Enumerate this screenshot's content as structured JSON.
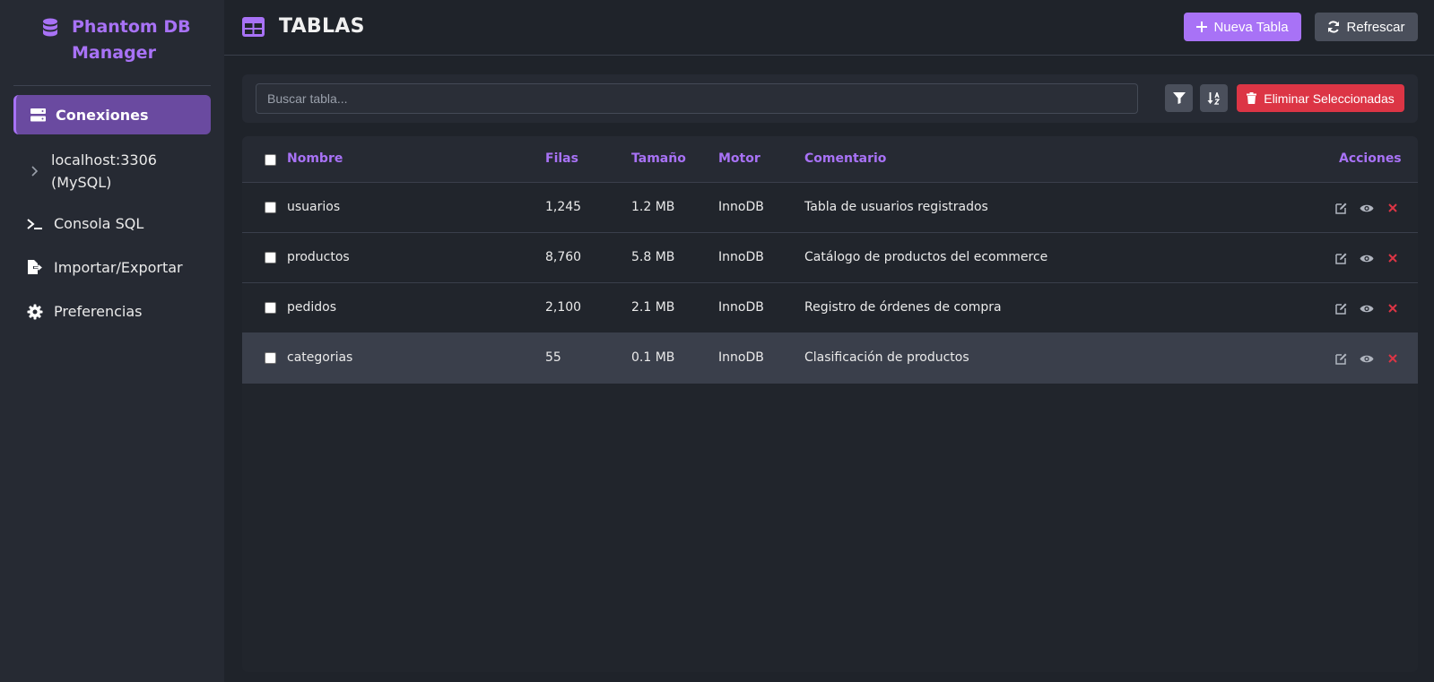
{
  "app": {
    "brand_line1": "Phantom DB",
    "brand_line2": "Manager",
    "accent": "#a872f6"
  },
  "sidebar": {
    "active": "Conexiones",
    "connection": {
      "line1": "localhost:3306",
      "line2": "(MySQL)"
    },
    "items": [
      {
        "label": "Consola SQL",
        "icon": "terminal-icon"
      },
      {
        "label": "Importar/Exportar",
        "icon": "file-export-icon"
      },
      {
        "label": "Preferencias",
        "icon": "gear-icon"
      }
    ]
  },
  "header": {
    "title": "TABLAS",
    "new_label": "Nueva Tabla",
    "refresh_label": "Refrescar"
  },
  "toolbar": {
    "search_placeholder": "Buscar tabla...",
    "delete_label": "Eliminar Seleccionadas",
    "danger_color": "#dc3545"
  },
  "table": {
    "columns": [
      "Nombre",
      "Filas",
      "Tamaño",
      "Motor",
      "Comentario",
      "Acciones"
    ],
    "rows": [
      {
        "nombre": "usuarios",
        "filas": "1,245",
        "tamano": "1.2 MB",
        "motor": "InnoDB",
        "comentario": "Tabla de usuarios registrados"
      },
      {
        "nombre": "productos",
        "filas": "8,760",
        "tamano": "5.8 MB",
        "motor": "InnoDB",
        "comentario": "Catálogo de productos del ecommerce"
      },
      {
        "nombre": "pedidos",
        "filas": "2,100",
        "tamano": "2.1 MB",
        "motor": "InnoDB",
        "comentario": "Registro de órdenes de compra"
      },
      {
        "nombre": "categorias",
        "filas": "55",
        "tamano": "0.1 MB",
        "motor": "InnoDB",
        "comentario": "Clasificación de productos"
      }
    ]
  }
}
